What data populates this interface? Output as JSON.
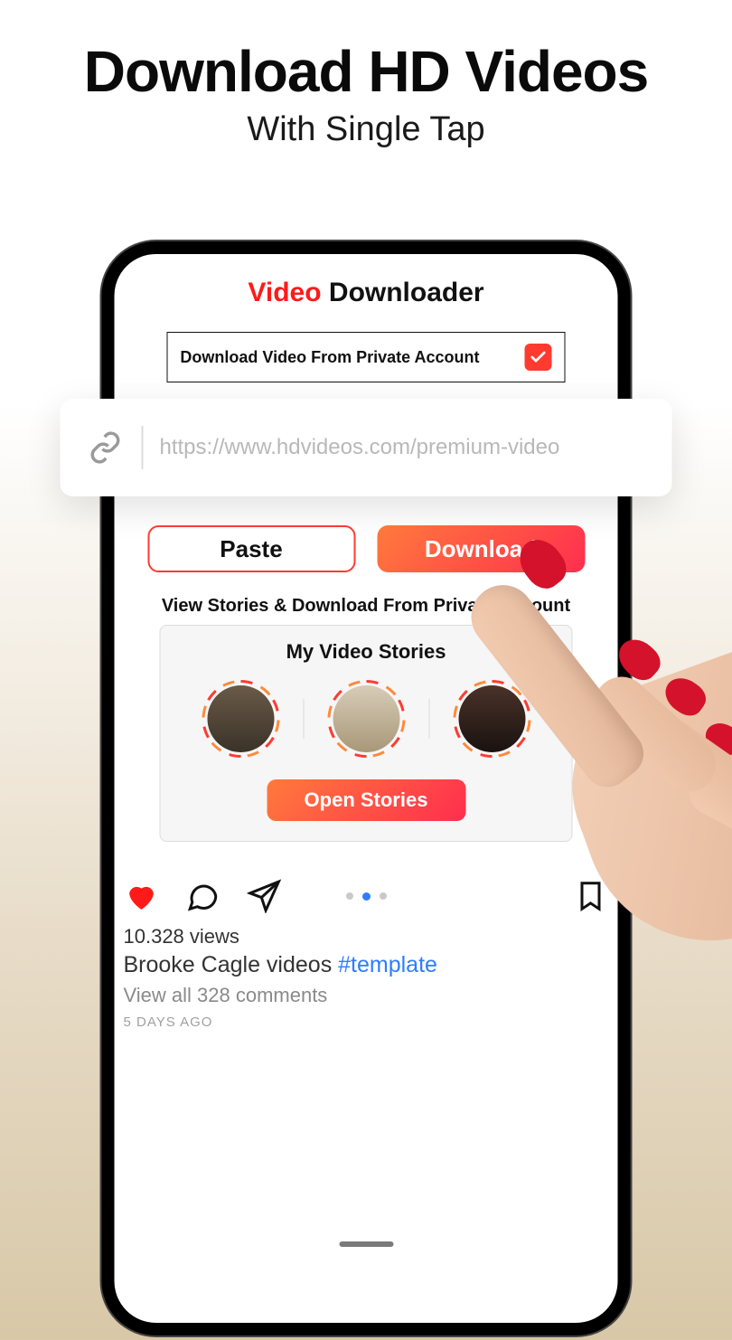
{
  "hero": {
    "title": "Download HD Videos",
    "subtitle": "With Single Tap"
  },
  "app": {
    "title_red": "Video",
    "title_rest": " Downloader",
    "private_label": "Download Video From Private Account",
    "url_placeholder": "https://www.hdvideos.com/premium-video",
    "paste_btn": "Paste",
    "download_btn": "Download",
    "section_label": "View Stories & Download From Private Account",
    "stories_title": "My Video Stories",
    "open_stories_btn": "Open Stories"
  },
  "post": {
    "views": "10.328 views",
    "caption_text": "Brooke Cagle videos ",
    "caption_tag": "#template",
    "comments": "View all 328 comments",
    "timestamp": "5 DAYS AGO"
  }
}
